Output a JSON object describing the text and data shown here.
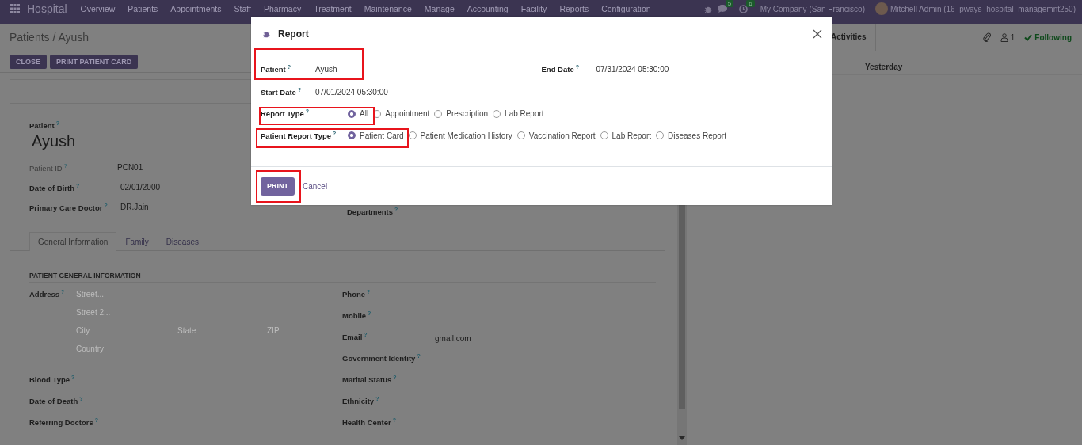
{
  "navbar": {
    "app_name": "Hospital",
    "menu": [
      "Overview",
      "Patients",
      "Appointments",
      "Staff",
      "Pharmacy",
      "Treatment",
      "Maintenance",
      "Manage",
      "Accounting",
      "Facility",
      "Reports",
      "Configuration"
    ],
    "chat_count": "5",
    "activity_count": "6",
    "company": "My Company (San Francisco)",
    "user": "Mitchell Admin (16_pways_hospital_managemnt250)"
  },
  "breadcrumb": "Patients / Ayush",
  "actions": [
    "CLOSE",
    "PRINT PATIENT CARD"
  ],
  "chatter": {
    "activities": "Activities",
    "followers": "1",
    "following": "Following",
    "day": "Yesterday"
  },
  "form": {
    "title_label": {
      "label": "Patient",
      "help": "?"
    },
    "name": "Ayush",
    "fields": [
      {
        "label": "Patient ID",
        "help": "?",
        "value": "PCN01",
        "kind": "readonly"
      },
      {
        "label": "Date of Birth",
        "help": "?",
        "value": "02/01/2000",
        "kind": "field"
      },
      {
        "label": "Primary Care Doctor",
        "help": "?",
        "value": "DR.Jain",
        "kind": "field"
      }
    ],
    "side_field": {
      "label": "Departments",
      "help": "?"
    },
    "tabs": [
      {
        "label": "General Information",
        "selected": true
      },
      {
        "label": "Family",
        "selected": false
      },
      {
        "label": "Diseases",
        "selected": false
      }
    ],
    "section": "PATIENT GENERAL INFORMATION",
    "address": {
      "label": "Address",
      "help": "?",
      "placeholders": [
        "Street...",
        "Street 2...",
        "City",
        "State",
        "ZIP",
        "Country"
      ]
    },
    "left_fields": [
      {
        "label": "Blood Type",
        "help": "?"
      },
      {
        "label": "Date of Death",
        "help": "?"
      },
      {
        "label": "Referring Doctors",
        "help": "?"
      }
    ],
    "right_fields": [
      {
        "label": "Phone",
        "help": "?"
      },
      {
        "label": "Mobile",
        "help": "?"
      },
      {
        "label": "Email",
        "help": "?",
        "value": "gmail.com"
      },
      {
        "label": "Government Identity",
        "help": "?"
      },
      {
        "label": "Marital Status",
        "help": "?"
      },
      {
        "label": "Ethnicity",
        "help": "?"
      },
      {
        "label": "Health Center",
        "help": "?"
      }
    ]
  },
  "dialog": {
    "title": "Report",
    "patient": {
      "label": "Patient",
      "help": "?",
      "value": "Ayush"
    },
    "end_date": {
      "label": "End Date",
      "help": "?",
      "value": "07/31/2024 05:30:00"
    },
    "start_date": {
      "label": "Start Date",
      "help": "?",
      "value": "07/01/2024 05:30:00"
    },
    "report_type": {
      "label": "Report Type",
      "help": "?",
      "options": [
        {
          "label": "All",
          "selected": true
        },
        {
          "label": "Appointment",
          "selected": false
        },
        {
          "label": "Prescription",
          "selected": false
        },
        {
          "label": "Lab Report",
          "selected": false
        }
      ]
    },
    "patient_report_type": {
      "label": "Patient Report Type",
      "help": "?",
      "options": [
        {
          "label": "Patient Card",
          "selected": true
        },
        {
          "label": "Patient Medication History",
          "selected": false
        },
        {
          "label": "Vaccination Report",
          "selected": false
        },
        {
          "label": "Lab Report",
          "selected": false
        },
        {
          "label": "Diseases Report",
          "selected": false
        }
      ]
    },
    "buttons": [
      {
        "label": "PRINT",
        "kind": "primary"
      },
      {
        "label": "Cancel",
        "kind": "link"
      }
    ]
  }
}
